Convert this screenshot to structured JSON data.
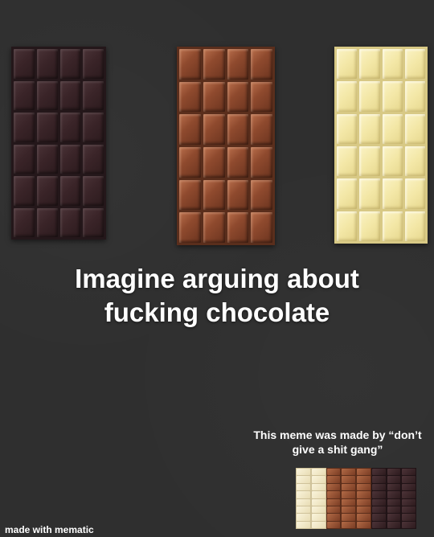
{
  "caption": {
    "line1": "Imagine arguing about",
    "line2": "fucking chocolate"
  },
  "credit": {
    "line1": "This meme was made by “don’t",
    "line2": "give a shit gang”"
  },
  "watermark": "made with mematic",
  "bars": [
    {
      "name": "dark chocolate",
      "rows": 6,
      "cols": 4
    },
    {
      "name": "milk chocolate",
      "rows": 6,
      "cols": 4
    },
    {
      "name": "white chocolate",
      "rows": 6,
      "cols": 4
    }
  ],
  "mini_bars": [
    "white",
    "white",
    "milk",
    "milk",
    "milk",
    "dark",
    "dark",
    "dark"
  ],
  "colors": {
    "background": "#2f2f2f",
    "text": "#ffffff",
    "dark_chocolate": "#3a2428",
    "milk_chocolate": "#8f4a2e",
    "white_chocolate": "#f3e7a6"
  }
}
